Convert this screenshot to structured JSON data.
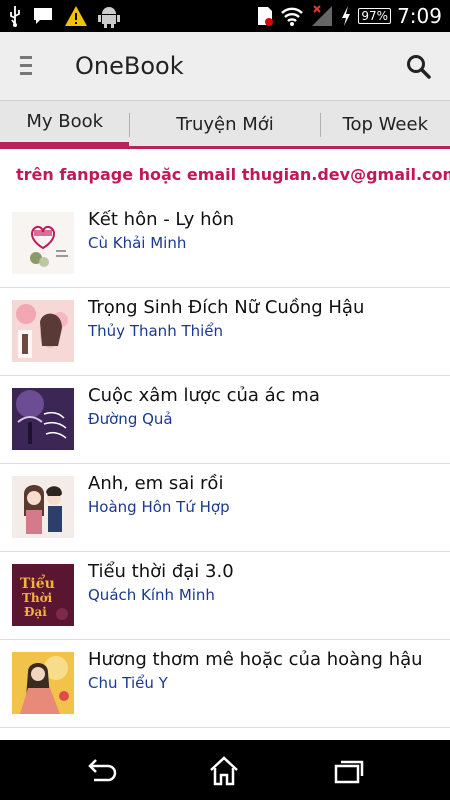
{
  "status_bar": {
    "time": "7:09",
    "battery": "97%",
    "icons": [
      "usb-icon",
      "chat-icon",
      "warning-icon",
      "android-icon",
      "sim-icon",
      "wifi-icon",
      "signal-icon",
      "charging-icon",
      "battery-icon"
    ]
  },
  "app_bar": {
    "title": "OneBook",
    "menu_icon": "menu-icon",
    "search_icon": "search-icon"
  },
  "tabs": [
    {
      "label": "My Book",
      "active": true
    },
    {
      "label": "Truyện Mới",
      "active": false
    },
    {
      "label": "Top Week",
      "active": false
    }
  ],
  "notice": "trên fanpage hoặc email thugian.dev@gmail.com nhé",
  "books": [
    {
      "title": "Kết hôn - Ly hôn",
      "author": "Cù Khải Minh"
    },
    {
      "title": "Trọng Sinh Đích Nữ Cuồng Hậu",
      "author": "Thủy Thanh Thiển"
    },
    {
      "title": "Cuộc xâm lược của ác ma",
      "author": "Đường Quả"
    },
    {
      "title": "Anh, em sai rồi",
      "author": "Hoàng Hôn Tứ Hợp"
    },
    {
      "title": "Tiểu thời đại 3.0",
      "author": "Quách Kính Minh"
    },
    {
      "title": "Hương thơm mê hoặc của hoàng hậu",
      "author": "Chu Tiểu Y"
    }
  ],
  "nav_bar": {
    "back": "back-icon",
    "home": "home-icon",
    "recents": "recents-icon"
  },
  "colors": {
    "accent": "#b8235a",
    "notice": "#c2185b",
    "author": "#1a3a8f"
  }
}
